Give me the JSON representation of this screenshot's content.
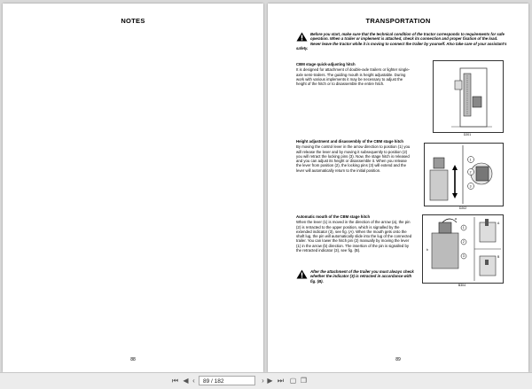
{
  "left_page": {
    "title": "NOTES",
    "page_number": "88"
  },
  "right_page": {
    "title": "TRANSPORTATION",
    "page_number": "89",
    "warning": "Before you start, make sure that the technical condition of the tractor corresponds to requirements for safe operation. When a trailer or implement is attached, check its connection and proper fixation of the load. Never leave the tractor while it is moving to connect the trailer by yourself. Also take care of your assistant's safety.",
    "sections": [
      {
        "heading": "CBM stage quick-adjusting hitch",
        "body": "It is designed for attachment of double-axle trailers or lighter single-axle semi-trailers. The guiding mouth is height adjustable. During work with various implements it may be necessary to adjust the height of the hitch or to disassemble the entire hitch.",
        "figure_caption": "D201"
      },
      {
        "heading": "Height adjustment and disassembly of the CBM stage hitch",
        "body": "By moving the control lever in the arrow direction to position (1) you will release the lever and by moving it subsequently to position (2) you will retract the locking pins (3). Now, the stage hitch is released and you can adjust its height or disassemble it. When you release the lever from position (2), the locking pins (3) will extend and the lever will automatically return to the initial position.",
        "figure_caption": "D202"
      },
      {
        "heading": "Automatic mouth of the CBM stage hitch",
        "body": "When the lever (1) is moved in the direction of the arrow (a), the pin (2) is retracted to the upper position, which is signalled by the extended indicator (3), see fig. (A). When the mouth gets onto the shaft lug, the pin will automatically slide into the lug of the connected trailer. You can lower the hitch pin (2) manually by moving the lever (1) in the arrow (b) direction. The insertion of the pin is signalled by the retracted indicator (3), see fig. (B).",
        "figure_caption": "B304"
      }
    ],
    "note": "After the attachment of the trailer you must always check whether the indicator (3) is retracted in accordance with fig. (B).",
    "figure_labels": {
      "a": "a",
      "b": "b",
      "A": "A",
      "B": "B",
      "n1": "1",
      "n2": "2",
      "n3": "3"
    }
  },
  "toolbar": {
    "page_input": "89 / 182",
    "icons": [
      "first-page-icon",
      "prev-page-icon",
      "next-page-icon",
      "last-page-icon",
      "back-icon",
      "forward-icon",
      "single-page-icon",
      "two-page-icon"
    ]
  }
}
